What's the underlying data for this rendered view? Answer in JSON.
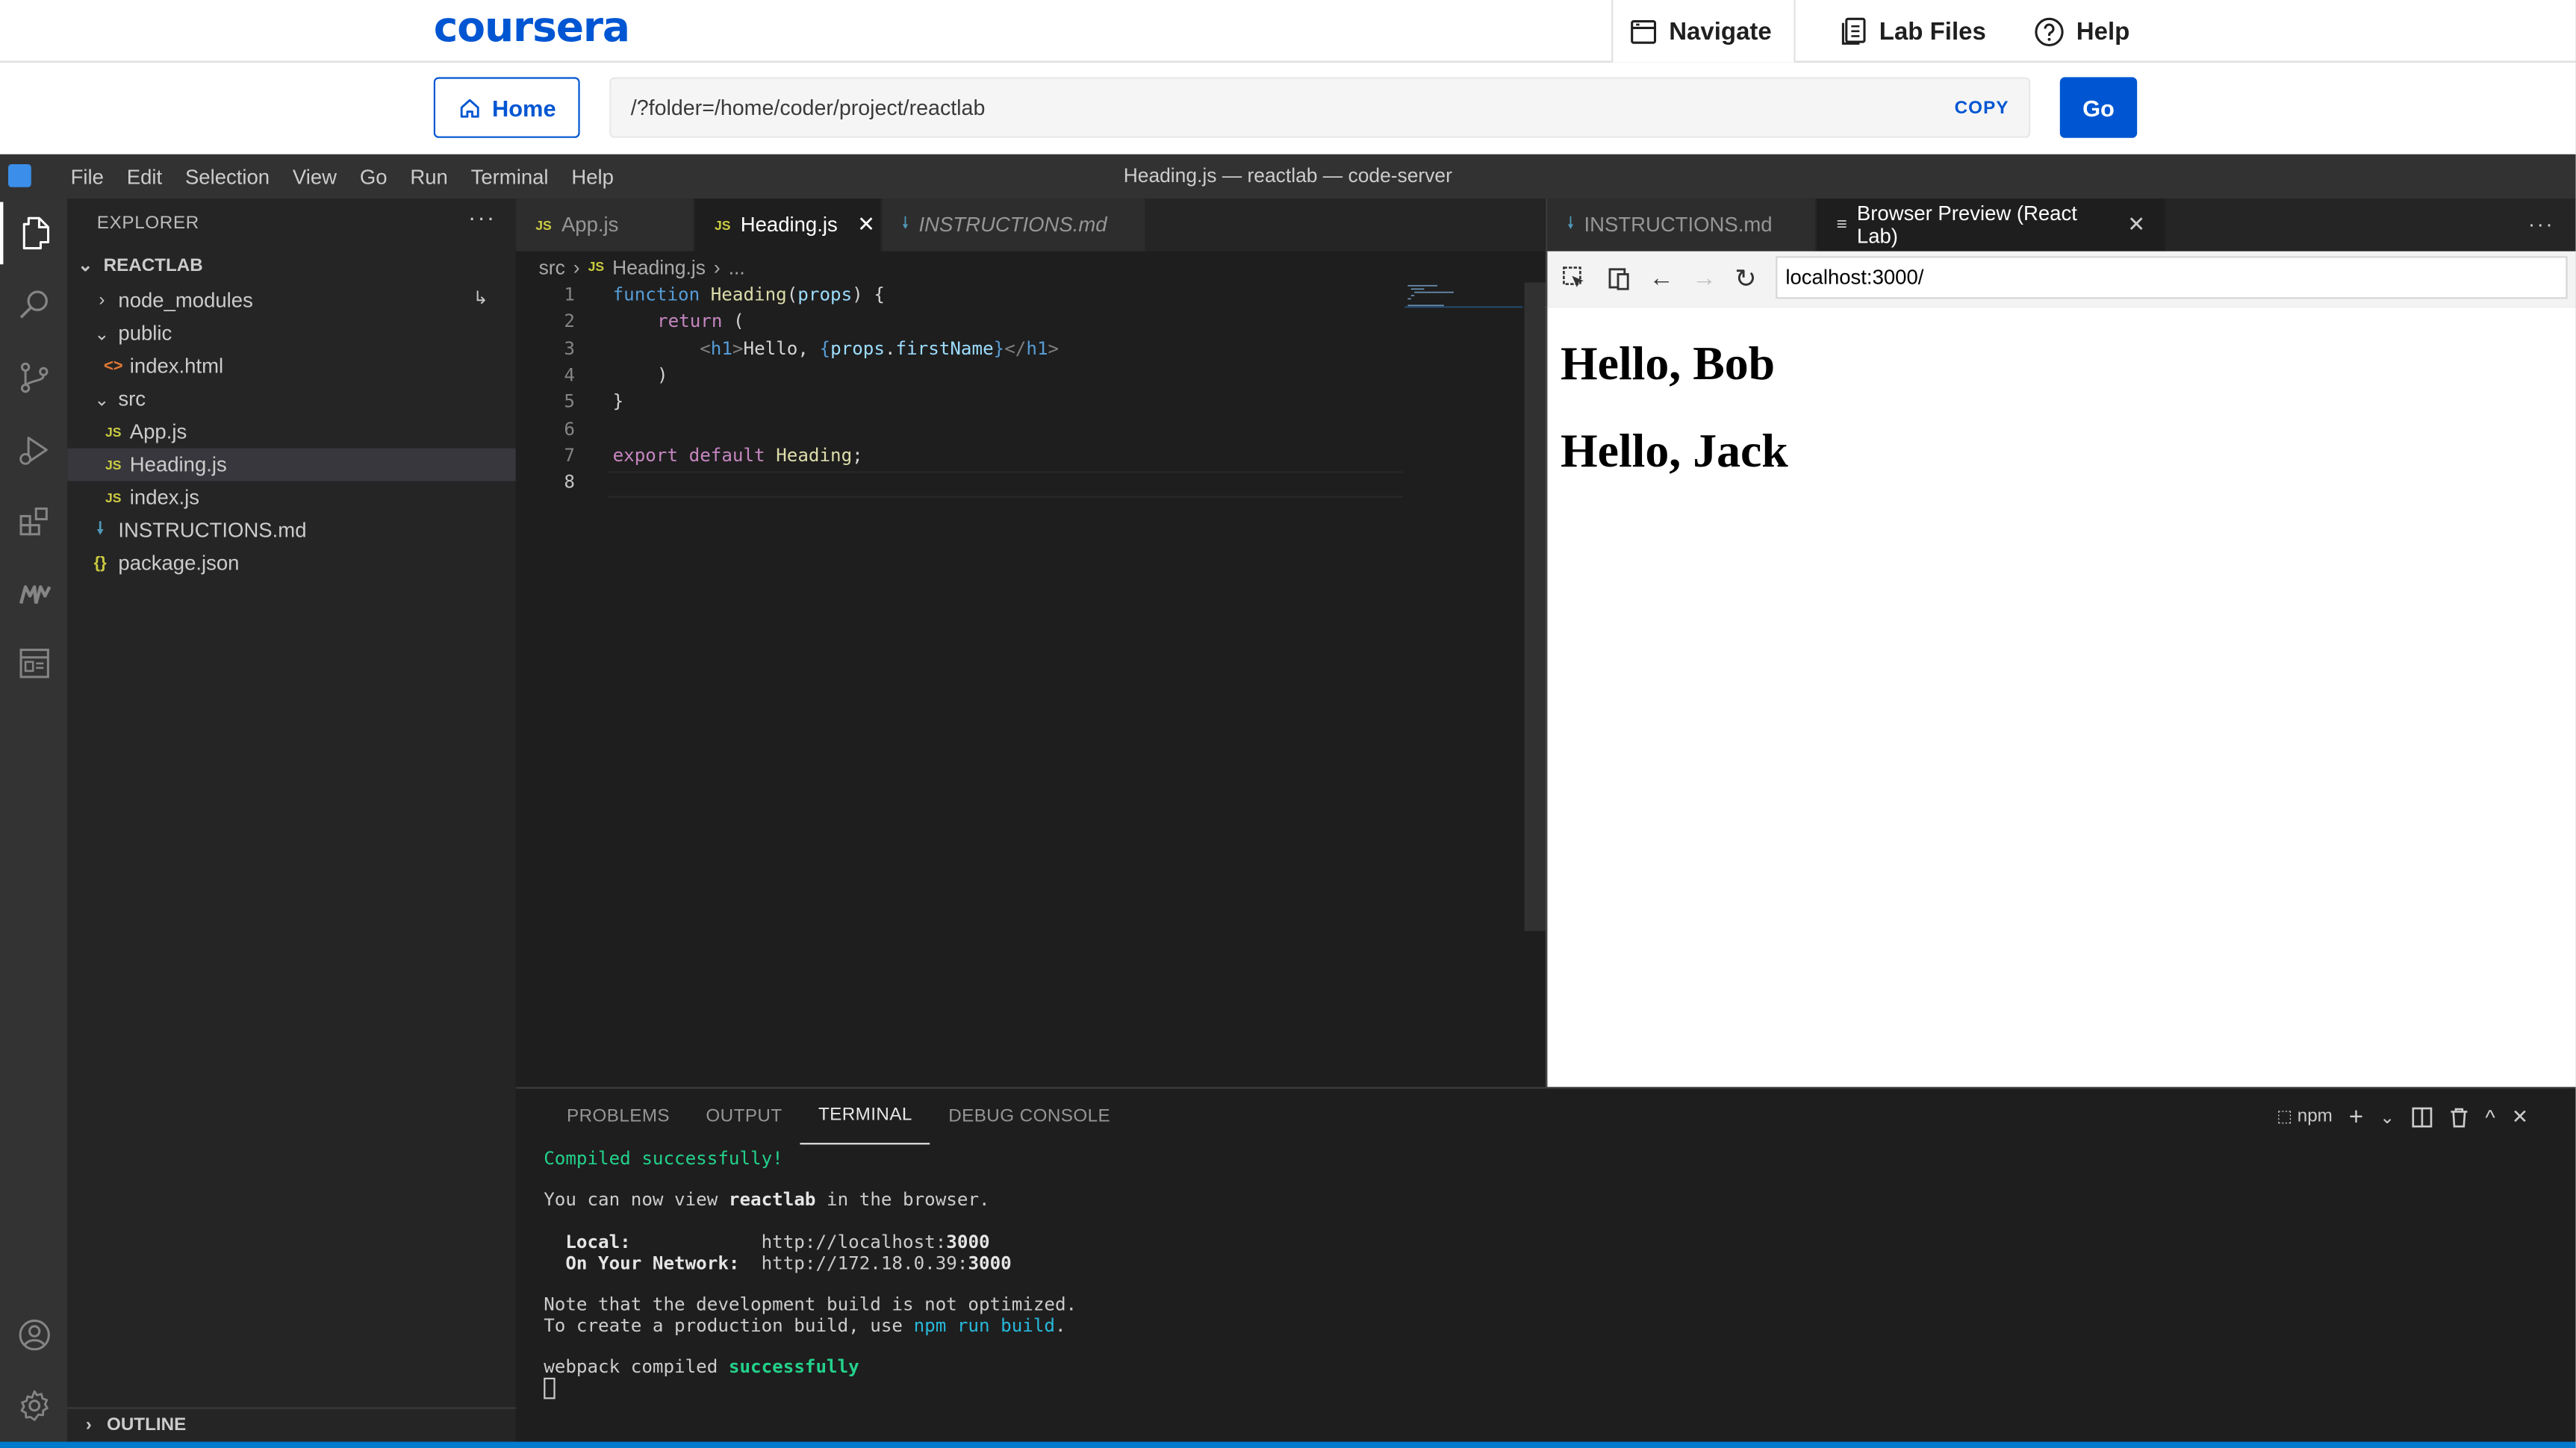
{
  "coursera": {
    "logo": "coursera",
    "navigate": "Navigate",
    "lab_files": "Lab Files",
    "help": "Help",
    "home": "Home",
    "path": "/?folder=/home/coder/project/reactlab",
    "copy": "COPY",
    "go": "Go"
  },
  "menu": [
    "File",
    "Edit",
    "Selection",
    "View",
    "Go",
    "Run",
    "Terminal",
    "Help"
  ],
  "window_title": "Heading.js — reactlab — code-server",
  "explorer": {
    "title": "EXPLORER",
    "more": "···",
    "root": "REACTLAB",
    "items": [
      {
        "label": "node_modules",
        "type": "folder"
      },
      {
        "label": "public",
        "type": "folder"
      },
      {
        "label": "index.html",
        "type": "html"
      },
      {
        "label": "src",
        "type": "folder"
      },
      {
        "label": "App.js",
        "type": "js"
      },
      {
        "label": "Heading.js",
        "type": "js",
        "selected": true
      },
      {
        "label": "index.js",
        "type": "js"
      },
      {
        "label": "INSTRUCTIONS.md",
        "type": "md"
      },
      {
        "label": "package.json",
        "type": "json"
      }
    ],
    "outline": "OUTLINE"
  },
  "editor_tabs": [
    {
      "label": "App.js",
      "icon": "JS"
    },
    {
      "label": "Heading.js",
      "icon": "JS",
      "active": true
    },
    {
      "label": "INSTRUCTIONS.md",
      "icon": "md-icon"
    }
  ],
  "breadcrumb": [
    "src",
    "Heading.js",
    "..."
  ],
  "code_lines": [
    "1",
    "2",
    "3",
    "4",
    "5",
    "6",
    "7",
    "8"
  ],
  "code": {
    "l1": [
      "function",
      "Heading",
      "(",
      "props",
      ") {"
    ],
    "l2": [
      "return",
      "("
    ],
    "l3": [
      "<h1>",
      "Hello, ",
      "{",
      "props",
      "firstName",
      "}",
      "</h1>"
    ],
    "l4": [
      ")"
    ],
    "l5": [
      "}"
    ],
    "l7": [
      "export",
      "default",
      "Heading",
      ";"
    ]
  },
  "right_tabs": [
    {
      "label": "INSTRUCTIONS.md"
    },
    {
      "label": "Browser Preview (React Lab)",
      "active": true
    }
  ],
  "preview": {
    "url": "localhost:3000/",
    "h1a": "Hello, Bob",
    "h1b": "Hello, Jack"
  },
  "panel": {
    "tabs": [
      "PROBLEMS",
      "OUTPUT",
      "TERMINAL",
      "DEBUG CONSOLE"
    ],
    "active_tab": "TERMINAL",
    "shell": "npm",
    "terminal": {
      "compiled": "Compiled successfully!",
      "view_pre": "You can now view ",
      "view_app": "reactlab",
      "view_post": " in the browser.",
      "local_label": "  Local:            ",
      "local_url": "http://localhost:",
      "local_port": "3000",
      "net_label": "  On Your Network:  ",
      "net_url": "http://172.18.0.39:",
      "net_port": "3000",
      "note1": "Note that the development build is not optimized.",
      "note2_pre": "To create a production build, use ",
      "note2_cmd": "npm run build",
      "note2_post": ".",
      "webpack_pre": "webpack compiled ",
      "webpack_ok": "successfully"
    }
  }
}
